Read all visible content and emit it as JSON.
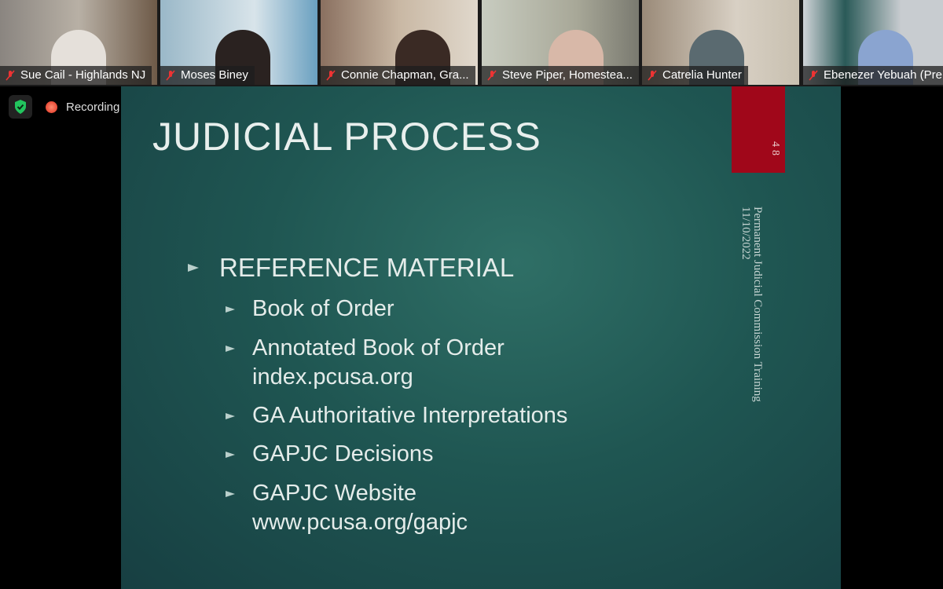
{
  "participants": [
    {
      "name": "Sue Cail - Highlands NJ",
      "muted": true
    },
    {
      "name": "Moses Biney",
      "muted": true
    },
    {
      "name": "Connie Chapman, Gra...",
      "muted": true
    },
    {
      "name": "Steve Piper, Homestea...",
      "muted": true
    },
    {
      "name": "Catrelia Hunter",
      "muted": true
    },
    {
      "name": "Ebenezer Yebuah (Pre",
      "muted": true
    }
  ],
  "status": {
    "recording_label": "Recording",
    "security": "shield-check-icon"
  },
  "slide": {
    "title": "JUDICIAL PROCESS",
    "page_number": "48",
    "footer_line1": "Permanent Judicial Commission Training",
    "footer_line2": "11/10/2022",
    "heading": "REFERENCE MATERIAL",
    "items": [
      {
        "l1": "Book of Order",
        "l2": ""
      },
      {
        "l1": "Annotated Book of Order",
        "l2": "index.pcusa.org"
      },
      {
        "l1": "GA Authoritative Interpretations",
        "l2": ""
      },
      {
        "l1": "GAPJC Decisions",
        "l2": ""
      },
      {
        "l1": "GAPJC Website",
        "l2": "www.pcusa.org/gapjc"
      }
    ]
  },
  "colors": {
    "slide_bg": "#1f5652",
    "accent_red": "#a0071a",
    "recording": "#e0301e",
    "secure": "#22c55e"
  }
}
